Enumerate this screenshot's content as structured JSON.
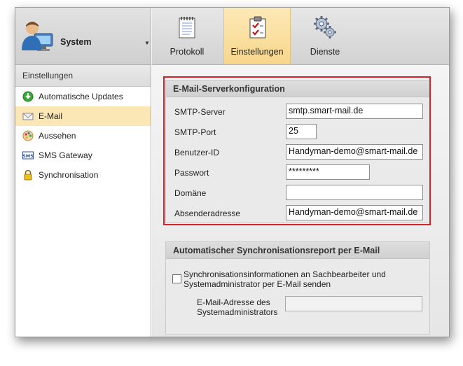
{
  "sidebar": {
    "header_title": "System",
    "section_title": "Einstellungen",
    "items": [
      {
        "label": "Automatische Updates",
        "icon": "update-icon"
      },
      {
        "label": "E-Mail",
        "icon": "mail-icon",
        "active": true
      },
      {
        "label": "Aussehen",
        "icon": "palette-icon"
      },
      {
        "label": "SMS Gateway",
        "icon": "sms-icon"
      },
      {
        "label": "Synchronisation",
        "icon": "lock-icon"
      }
    ]
  },
  "ribbon": {
    "buttons": [
      {
        "label": "Protokoll",
        "icon": "notepad-icon"
      },
      {
        "label": "Einstellungen",
        "icon": "checklist-icon",
        "active": true
      },
      {
        "label": "Dienste",
        "icon": "gears-icon"
      }
    ]
  },
  "smtp": {
    "title": "E-Mail-Serverkonfiguration",
    "fields": [
      {
        "label": "SMTP-Server",
        "value": "smtp.smart-mail.de"
      },
      {
        "label": "SMTP-Port",
        "value": "25"
      },
      {
        "label": "Benutzer-ID",
        "value": "Handyman-demo@smart-mail.de"
      },
      {
        "label": "Passwort",
        "value": "*********"
      },
      {
        "label": "Domäne",
        "value": ""
      },
      {
        "label": "Absenderadresse",
        "value": "Handyman-demo@smart-mail.de"
      }
    ]
  },
  "sync_report": {
    "title": "Automatischer Synchronisationsreport per E-Mail",
    "checkbox_label": "Synchronisationsinformationen an Sachbearbeiter und Systemadministrator per E-Mail senden",
    "checkbox_checked": false,
    "admin_email_label": "E-Mail-Adresse des Systemadministrators",
    "admin_email_value": ""
  },
  "colors": {
    "highlight": "#d9202a",
    "active_bg": "#fbe6b6"
  }
}
